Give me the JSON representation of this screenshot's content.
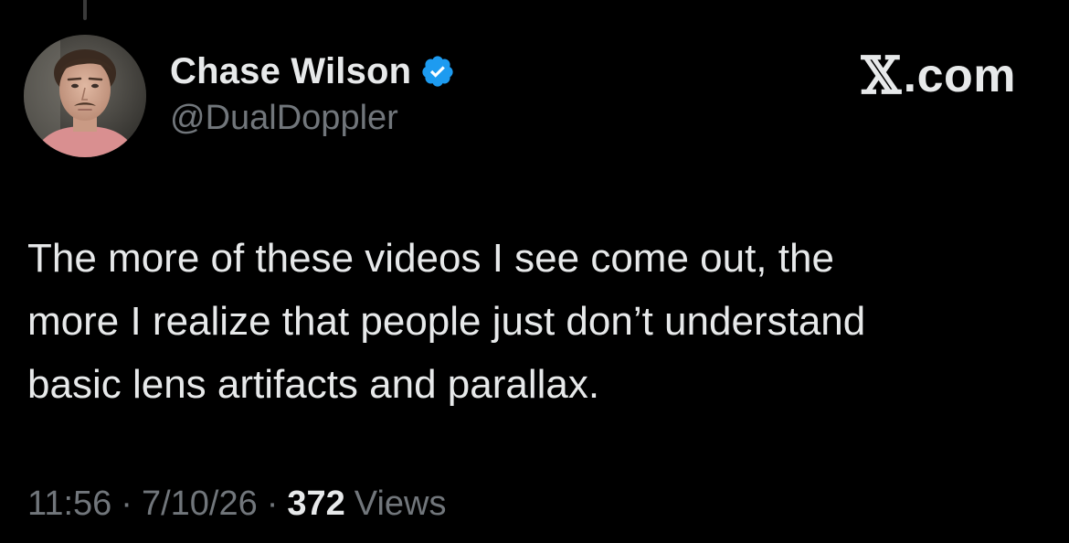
{
  "author": {
    "display_name": "Chase Wilson",
    "handle": "@DualDoppler",
    "verified": true,
    "verified_icon": "verified-badge-icon",
    "verified_color": "#1d9bf0"
  },
  "brand": {
    "logo_text": "𝕏",
    "domain_suffix": ".com"
  },
  "tweet": {
    "text": "The more of these videos I see come out, the\nmore I realize that people just don’t understand\nbasic lens artifacts and parallax."
  },
  "meta": {
    "time": "11:56",
    "separator": "·",
    "date": "7/10/26",
    "views_count": "372",
    "views_label": "Views"
  },
  "colors": {
    "background": "#000000",
    "primary_text": "#e7e9ea",
    "secondary_text": "#71767b",
    "accent": "#1d9bf0"
  }
}
